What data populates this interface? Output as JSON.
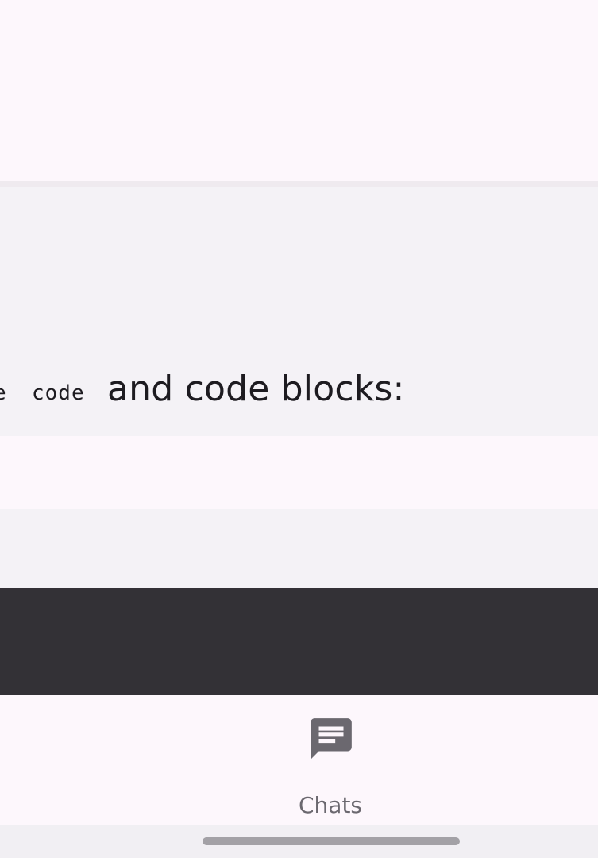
{
  "message": {
    "code_fragment": "e",
    "inline_code": "code",
    "text_after": "and code blocks:"
  },
  "bottom_nav": {
    "items": [
      {
        "label": "Chats",
        "icon": "chat-icon"
      }
    ]
  },
  "colors": {
    "background": "#fdf7fc",
    "card": "#f4f2f6",
    "dark_panel": "#333136",
    "nav_icon": "#6b686f"
  }
}
